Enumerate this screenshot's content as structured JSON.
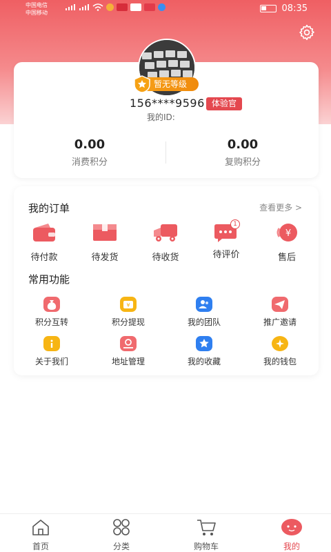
{
  "status_bar": {
    "carrier_1": "中国电信",
    "carrier_2": "中国移动",
    "time": "08:35"
  },
  "profile": {
    "level_badge": "暂无等级",
    "phone": "156****9596",
    "role_badge": "体验官",
    "id_label": "我的ID:",
    "stats": [
      {
        "value": "0.00",
        "label": "消费积分"
      },
      {
        "value": "0.00",
        "label": "复购积分"
      }
    ]
  },
  "orders": {
    "title": "我的订单",
    "see_more": "查看更多 >",
    "items": [
      {
        "label": "待付款",
        "icon": "wallet-icon"
      },
      {
        "label": "待发货",
        "icon": "package-icon"
      },
      {
        "label": "待收货",
        "icon": "truck-icon"
      },
      {
        "label": "待评价",
        "icon": "comment-icon",
        "badge": "1"
      },
      {
        "label": "售后",
        "icon": "refund-icon"
      }
    ]
  },
  "functions": {
    "title": "常用功能",
    "items": [
      {
        "label": "积分互转",
        "icon": "money-bag-icon",
        "color": "#f06a6e"
      },
      {
        "label": "积分提现",
        "icon": "withdraw-icon",
        "color": "#f7b514"
      },
      {
        "label": "我的团队",
        "icon": "team-icon",
        "color": "#2f7ff0"
      },
      {
        "label": "推广邀请",
        "icon": "share-icon",
        "color": "#f06a6e"
      },
      {
        "label": "关于我们",
        "icon": "info-icon",
        "color": "#f7b514"
      },
      {
        "label": "地址管理",
        "icon": "location-icon",
        "color": "#f06a6e"
      },
      {
        "label": "我的收藏",
        "icon": "star-icon",
        "color": "#2f7ff0"
      },
      {
        "label": "我的钱包",
        "icon": "wallet-coin-icon",
        "color": "#f7b514"
      }
    ]
  },
  "tabbar": {
    "items": [
      {
        "label": "首页",
        "icon": "home-icon"
      },
      {
        "label": "分类",
        "icon": "grid-icon"
      },
      {
        "label": "购物车",
        "icon": "cart-icon"
      },
      {
        "label": "我的",
        "icon": "profile-face-icon",
        "active": true
      }
    ]
  },
  "colors": {
    "accent": "#e4484f",
    "header_gradient_top": "#ef5f63",
    "gold": "#f7a21b",
    "blue": "#2f7ff0"
  }
}
